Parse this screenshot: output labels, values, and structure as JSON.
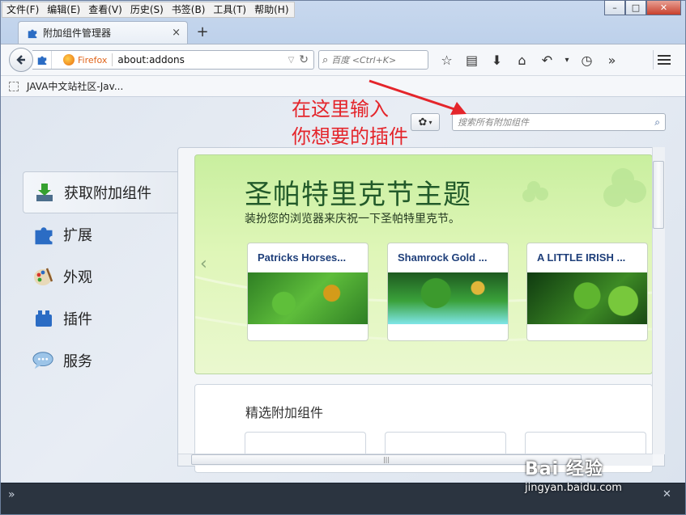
{
  "menubar": {
    "items": [
      "文件(F)",
      "编辑(E)",
      "查看(V)",
      "历史(S)",
      "书签(B)",
      "工具(T)",
      "帮助(H)"
    ]
  },
  "window_controls": {
    "minimize": "–",
    "maximize": "□",
    "close": "✕"
  },
  "tab": {
    "title": "附加组件管理器",
    "close": "×",
    "new_tab": "+"
  },
  "urlbar": {
    "brand": "Firefox",
    "url": "about:addons"
  },
  "searchbar": {
    "placeholder": "百度 <Ctrl+K>"
  },
  "toolbar_icons": [
    "star-icon",
    "reading-list-icon",
    "download-icon",
    "home-icon",
    "undo-icon",
    "dropdown-icon",
    "history-icon",
    "overflow-icon"
  ],
  "bookmarks": {
    "item": "JAVA中文站社区-Jav..."
  },
  "annotation": {
    "text": "在这里输入\n你想要的插件"
  },
  "addon_search": {
    "placeholder": "搜索所有附加组件"
  },
  "sidebar": {
    "items": [
      {
        "label": "获取附加组件",
        "icon": "download-addon-icon",
        "selected": true
      },
      {
        "label": "扩展",
        "icon": "puzzle-icon",
        "selected": false
      },
      {
        "label": "外观",
        "icon": "palette-icon",
        "selected": false
      },
      {
        "label": "插件",
        "icon": "lego-icon",
        "selected": false
      },
      {
        "label": "服务",
        "icon": "chat-bubble-icon",
        "selected": false
      }
    ]
  },
  "hero": {
    "title": "圣帕特里克节主题",
    "subtitle": "装扮您的浏览器来庆祝一下圣帕特里克节。",
    "cards": [
      {
        "title": "Patricks Horses..."
      },
      {
        "title": "Shamrock Gold ..."
      },
      {
        "title": "A LITTLE IRISH ..."
      }
    ]
  },
  "featured": {
    "title": "精选附加组件"
  },
  "watermark": {
    "brand": "Bai 经验",
    "url": "jingyan.baidu.com"
  },
  "colors": {
    "annotation": "#e4252b",
    "hero_title": "#225a2a",
    "card_title": "#1f3f7a"
  }
}
